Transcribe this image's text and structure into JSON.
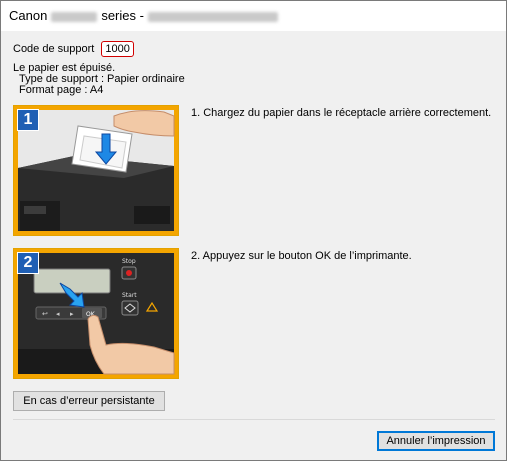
{
  "window": {
    "title_prefix": "Canon",
    "title_series": "series -"
  },
  "support": {
    "code_label": "Code de support",
    "code_value": "1000"
  },
  "message": {
    "line1": "Le papier est épuisé.",
    "line2": "Type de support : Papier ordinaire",
    "line3": "Format page : A4"
  },
  "steps": [
    {
      "badge": "1",
      "text": "1.  Chargez du papier dans le réceptacle arrière correctement."
    },
    {
      "badge": "2",
      "text": "2.  Appuyez sur le bouton OK de l’imprimante."
    }
  ],
  "printer_panel": {
    "stop_label": "Stop",
    "start_label": "Start",
    "ok_label": "OK"
  },
  "buttons": {
    "persist": "En cas d’erreur persistante",
    "cancel": "Annuler l’impression"
  },
  "colors": {
    "accent": "#0078d7",
    "code_border": "#d10000",
    "badge_blue": "#1f5fb4",
    "image_frame": "#f4a500"
  }
}
